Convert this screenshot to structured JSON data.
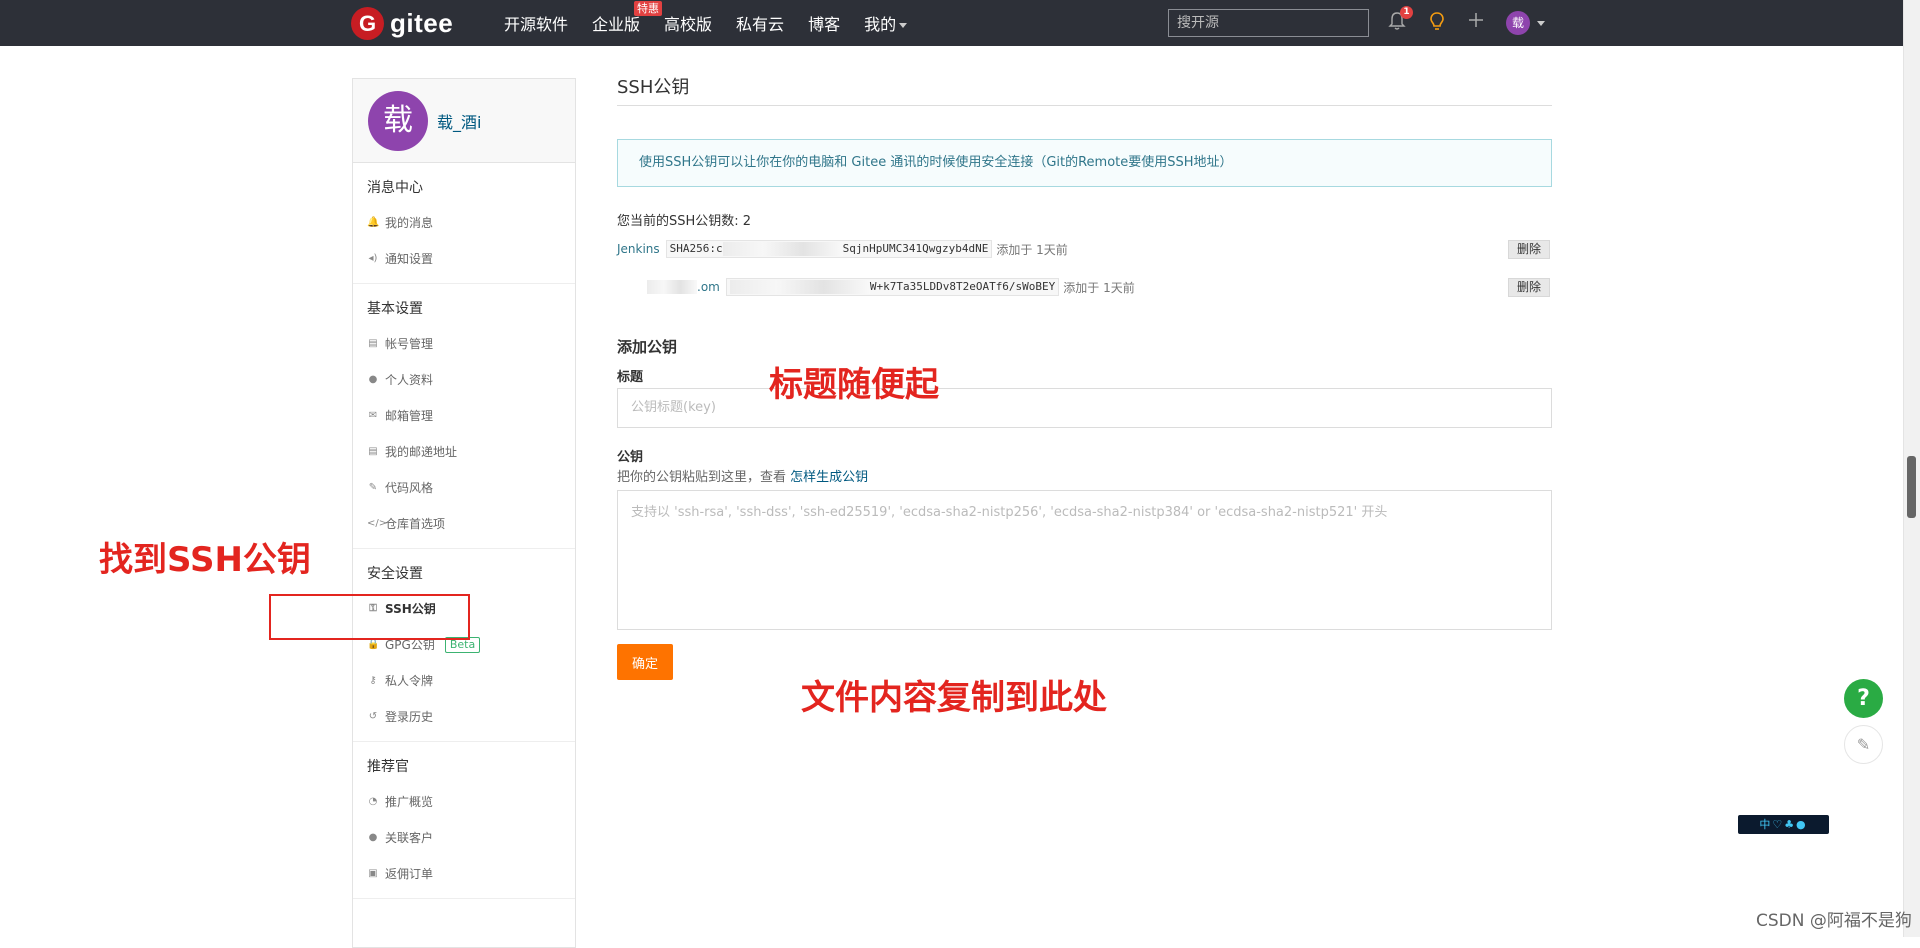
{
  "header": {
    "logo_mark": "G",
    "logo_text": "gitee",
    "nav": [
      {
        "label": "开源软件"
      },
      {
        "label": "企业版",
        "badge": "特惠"
      },
      {
        "label": "高校版"
      },
      {
        "label": "私有云"
      },
      {
        "label": "博客"
      },
      {
        "label": "我的"
      }
    ],
    "search_placeholder": "搜开源",
    "notification_count": "1",
    "avatar_char": "载",
    "icons": [
      "bell-icon",
      "lightbulb-icon",
      "plus-icon",
      "avatar"
    ]
  },
  "sidebar": {
    "avatar_char": "载",
    "username": "载_酒i",
    "sections": [
      {
        "title": "消息中心",
        "items": [
          {
            "label": "我的消息",
            "icon": "bell-icon"
          },
          {
            "label": "通知设置",
            "icon": "speaker-icon"
          }
        ]
      },
      {
        "title": "基本设置",
        "items": [
          {
            "label": "帐号管理",
            "icon": "id-card-icon"
          },
          {
            "label": "个人资料",
            "icon": "user-icon"
          },
          {
            "label": "邮箱管理",
            "icon": "envelope-icon"
          },
          {
            "label": "我的邮递地址",
            "icon": "address-card-icon"
          },
          {
            "label": "代码风格",
            "icon": "brush-icon"
          },
          {
            "label": "仓库首选项",
            "icon": "code-icon"
          }
        ]
      },
      {
        "title": "安全设置",
        "items": [
          {
            "label": "SSH公钥",
            "icon": "key-icon",
            "active": true
          },
          {
            "label": "GPG公钥",
            "icon": "lock-icon",
            "badge": "Beta"
          },
          {
            "label": "私人令牌",
            "icon": "token-icon"
          },
          {
            "label": "登录历史",
            "icon": "history-icon"
          }
        ]
      },
      {
        "title": "推荐官",
        "items": [
          {
            "label": "推广概览",
            "icon": "dashboard-icon"
          },
          {
            "label": "关联客户",
            "icon": "user-link-icon"
          },
          {
            "label": "返佣订单",
            "icon": "order-icon"
          }
        ]
      }
    ]
  },
  "main": {
    "title": "SSH公钥",
    "info": "使用SSH公钥可以让你在你的电脑和 Gitee 通讯的时候使用安全连接（Git的Remote要使用SSH地址）",
    "count_label": "您当前的SSH公钥数: 2",
    "keys": [
      {
        "title": "Jenkins",
        "fingerprint_prefix": "SHA256:c",
        "fingerprint_suffix": "SqjnHpUMC341Qwgzyb4dNE",
        "added": "添加于 1天前",
        "delete": "删除"
      },
      {
        "title": ".om",
        "fingerprint_prefix": "",
        "fingerprint_suffix": "W+k7Ta35LDDv8T2eOATf6/sWoBEY",
        "added": "添加于 1天前",
        "delete": "删除"
      }
    ],
    "form_title": "添加公钥",
    "title_label": "标题",
    "title_placeholder": "公钥标题(key)",
    "key_label": "公钥",
    "key_hint_text": "把你的公钥粘贴到这里，查看 ",
    "key_hint_link": "怎样生成公钥",
    "key_placeholder": "支持以 'ssh-rsa', 'ssh-dss', 'ssh-ed25519', 'ecdsa-sha2-nistp256', 'ecdsa-sha2-nistp384' or 'ecdsa-sha2-nistp521' 开头",
    "submit": "确定"
  },
  "annotations": {
    "find_ssh": "找到SSH公钥",
    "title_any": "标题随便起",
    "copy_here": "文件内容复制到此处",
    "color": "#e3251f"
  },
  "floating": {
    "help": "?",
    "toolbar": "中♡♣●"
  },
  "watermark": "CSDN @阿福不是狗",
  "colors": {
    "topbar": "#2d3038",
    "accent": "#fe7300",
    "link": "#005980",
    "info_border": "#a7d9e0"
  }
}
